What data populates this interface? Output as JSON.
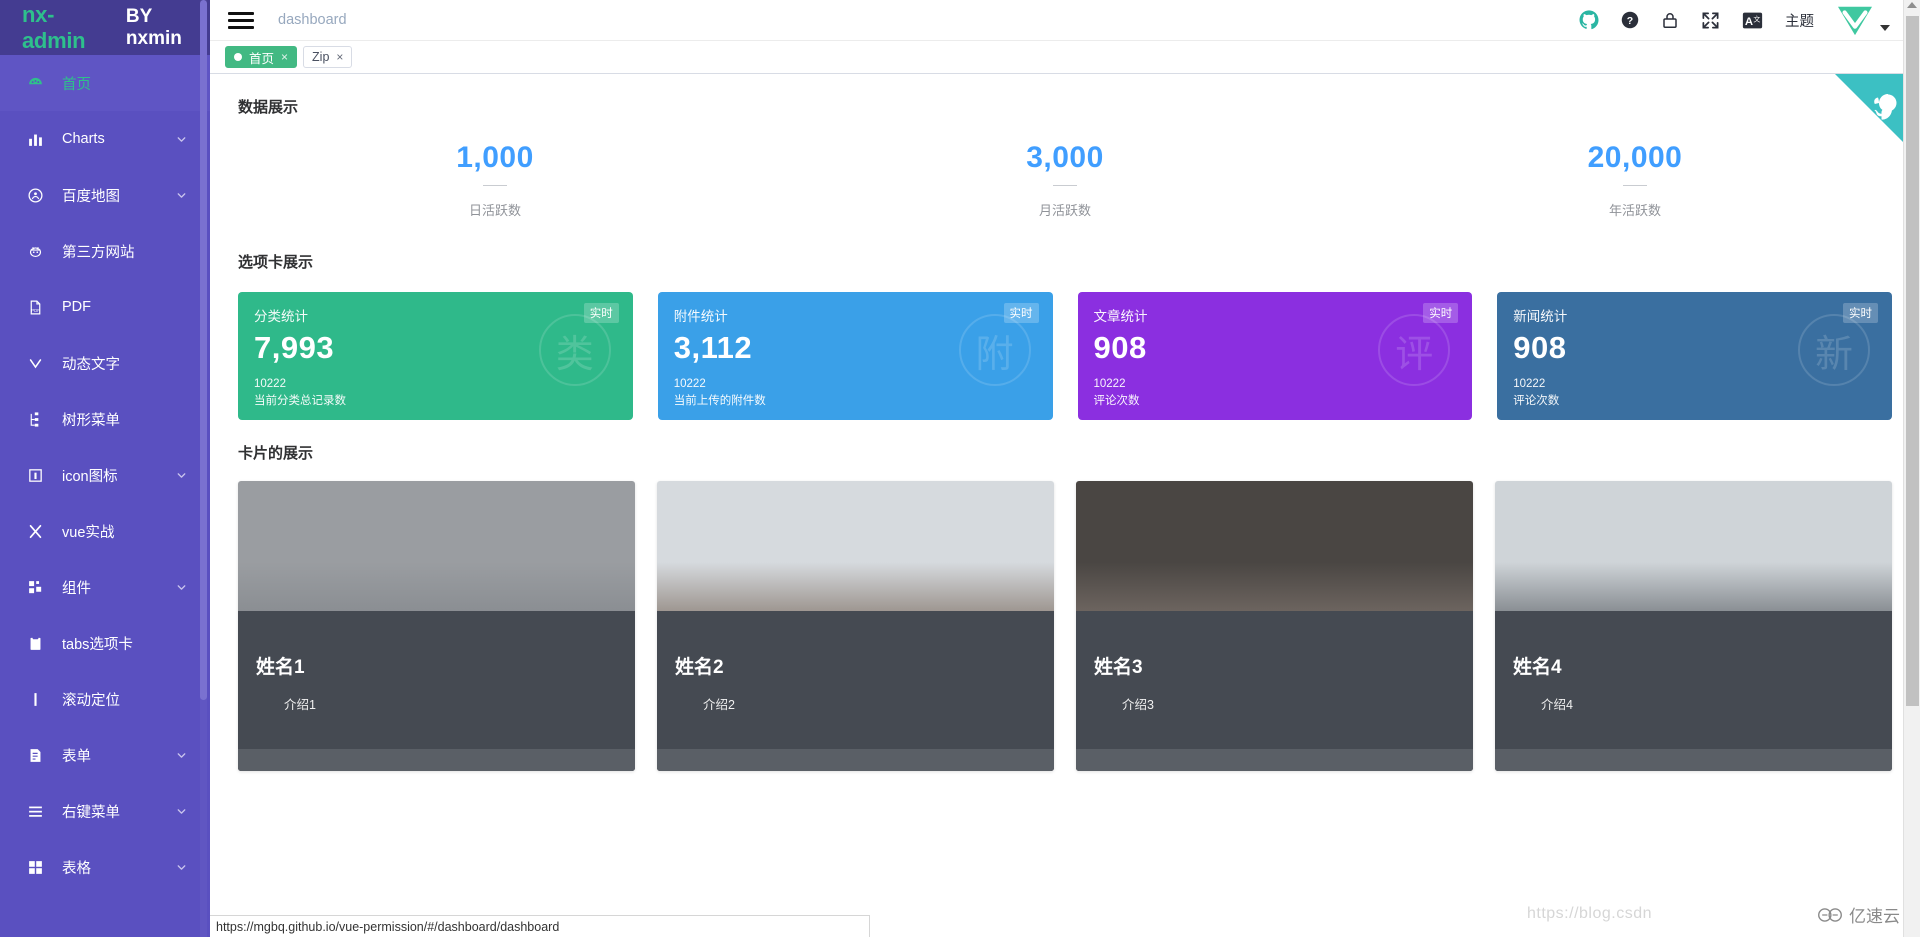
{
  "sidebar": {
    "logo_main": "nx-admin",
    "logo_sub": "BY nxmin",
    "items": [
      {
        "label": "首页",
        "icon": "dashboard-icon",
        "active": true,
        "expandable": false
      },
      {
        "label": "Charts",
        "icon": "bar-chart-icon",
        "active": false,
        "expandable": true
      },
      {
        "label": "百度地图",
        "icon": "map-pin-icon",
        "active": false,
        "expandable": true
      },
      {
        "label": "第三方网站",
        "icon": "link-globe-icon",
        "active": false,
        "expandable": false
      },
      {
        "label": "PDF",
        "icon": "pdf-file-icon",
        "active": false,
        "expandable": false
      },
      {
        "label": "动态文字",
        "icon": "text-anim-icon",
        "active": false,
        "expandable": false
      },
      {
        "label": "树形菜单",
        "icon": "tree-menu-icon",
        "active": false,
        "expandable": false
      },
      {
        "label": "icon图标",
        "icon": "icon-square-icon",
        "active": false,
        "expandable": true
      },
      {
        "label": "vue实战",
        "icon": "scissors-icon",
        "active": false,
        "expandable": false
      },
      {
        "label": "组件",
        "icon": "grid-icon",
        "active": false,
        "expandable": true
      },
      {
        "label": "tabs选项卡",
        "icon": "clipboard-icon",
        "active": false,
        "expandable": false
      },
      {
        "label": "滚动定位",
        "icon": "bar-vertical-icon",
        "active": false,
        "expandable": false
      },
      {
        "label": "表单",
        "icon": "form-icon",
        "active": false,
        "expandable": true
      },
      {
        "label": "右键菜单",
        "icon": "hamburger-menu-icon",
        "active": false,
        "expandable": true
      },
      {
        "label": "表格",
        "icon": "table-grid-icon",
        "active": false,
        "expandable": true
      }
    ]
  },
  "topbar": {
    "menu_toggle": "hamburger-icon",
    "breadcrumb": "dashboard",
    "icons": [
      {
        "name": "github-icon",
        "glyph": "github"
      },
      {
        "name": "help-icon",
        "glyph": "question"
      },
      {
        "name": "lock-icon",
        "glyph": "lock"
      },
      {
        "name": "fullscreen-icon",
        "glyph": "expand"
      },
      {
        "name": "translate-icon",
        "glyph": "translate"
      }
    ],
    "theme_label": "主题",
    "avatar": "green-diamond-avatar"
  },
  "tabs": [
    {
      "label": "首页",
      "active": true,
      "closable": true,
      "close_label": "×"
    },
    {
      "label": "Zip",
      "active": false,
      "closable": true,
      "close_label": "×"
    }
  ],
  "sections": {
    "data_display_title": "数据展示",
    "tab_display_title": "选项卡展示",
    "card_display_title": "卡片的展示"
  },
  "stats": [
    {
      "value": "1,000",
      "label": "日活跃数"
    },
    {
      "value": "3,000",
      "label": "月活跃数"
    },
    {
      "value": "20,000",
      "label": "年活跃数"
    }
  ],
  "panels": [
    {
      "title": "分类统计",
      "number": "7,993",
      "badge": "实时",
      "sub1": "10222",
      "sub2": "当前分类总记录数",
      "color": "#2fb98a",
      "mark": "类"
    },
    {
      "title": "附件统计",
      "number": "3,112",
      "badge": "实时",
      "sub1": "10222",
      "sub2": "当前上传的附件数",
      "color": "#3aa0e8",
      "mark": "附"
    },
    {
      "title": "文章统计",
      "number": "908",
      "badge": "实时",
      "sub1": "10222",
      "sub2": "评论次数",
      "color": "#8b2fe0",
      "mark": "评"
    },
    {
      "title": "新闻统计",
      "number": "908",
      "badge": "实时",
      "sub1": "10222",
      "sub2": "评论次数",
      "color": "#3a6fa0",
      "mark": "新"
    }
  ],
  "people": [
    {
      "name": "姓名1",
      "desc": "介绍1",
      "bg_top": "#9a9da1",
      "bg_mid": "#7d8186"
    },
    {
      "name": "姓名2",
      "desc": "介绍2",
      "bg_top": "#d6dade",
      "bg_mid": "#6c5a4c"
    },
    {
      "name": "姓名3",
      "desc": "介绍3",
      "bg_top": "#4a4643",
      "bg_mid": "#8b7f78"
    },
    {
      "name": "姓名4",
      "desc": "介绍4",
      "bg_top": "#cfd4d8",
      "bg_mid": "#4c5157"
    }
  ],
  "statusbar": {
    "url": "https://mgbq.github.io/vue-permission/#/dashboard/dashboard"
  },
  "watermarks": {
    "csdn": "https://blog.csdn",
    "yisu": "亿速云"
  },
  "colors": {
    "sidebar": "#5a50c0",
    "sidebar_header": "#443c91",
    "accent_green": "#2fc08b",
    "stat_blue": "#409eff",
    "ribbon_teal": "#3cc0c3"
  }
}
